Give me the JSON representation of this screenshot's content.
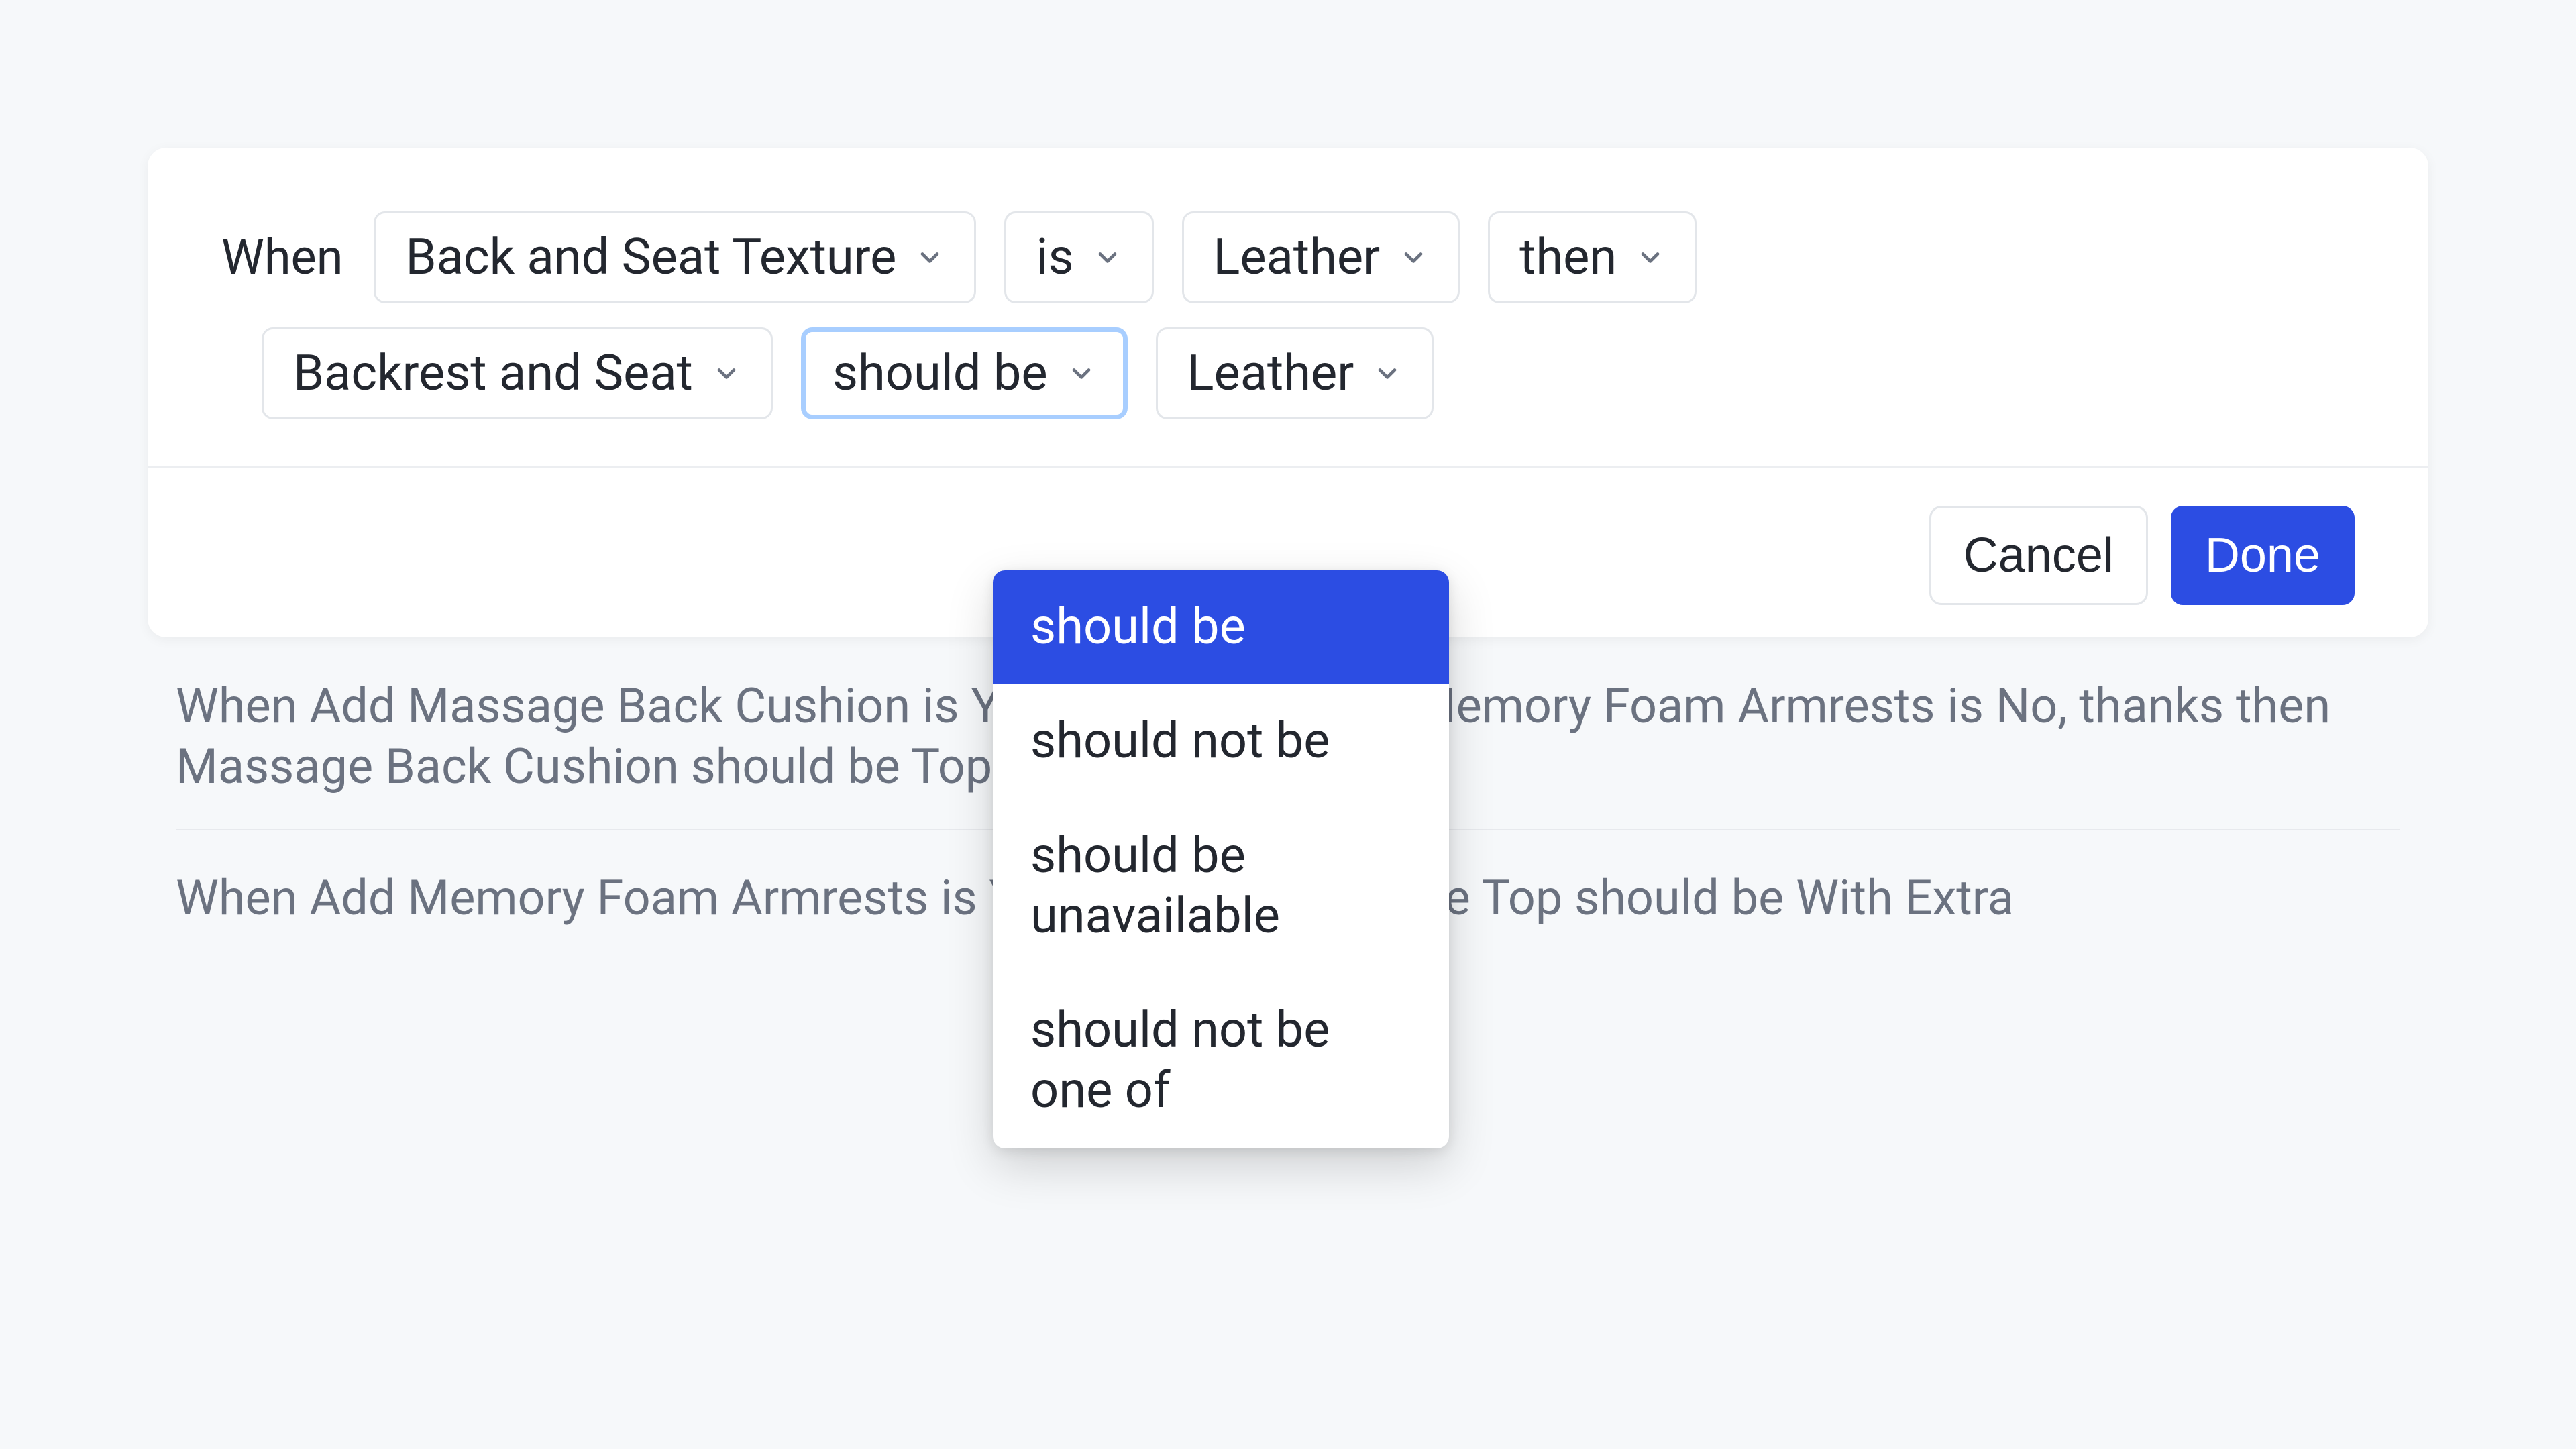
{
  "editor": {
    "when_label": "When",
    "row1": {
      "field1": "Back and Seat Texture",
      "op": "is",
      "value": "Leather",
      "then": "then"
    },
    "row2": {
      "target": "Backrest and Seat",
      "should": "should be",
      "value2": "Leather"
    },
    "footer": {
      "cancel": "Cancel",
      "done": "Done"
    }
  },
  "dropdown_options": {
    "items": [
      {
        "label": "should be"
      },
      {
        "label": "should not be"
      },
      {
        "label": "should be unavailable"
      },
      {
        "label": "should not be one of"
      }
    ]
  },
  "background_rules": {
    "line1": "When Add Massage Back Cushion is Yes, please and Add Memory Foam Armrests is No, thanks then Massage Back Cushion should be Top",
    "line2": "When Add Memory Foam Armrests is Yes, please then Circle Top should be With Extra"
  }
}
